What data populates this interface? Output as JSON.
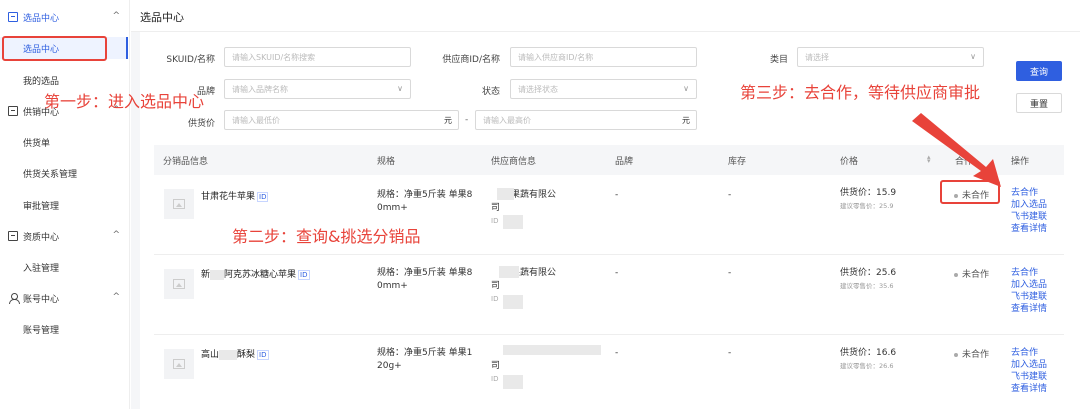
{
  "sidebar": {
    "groups": [
      {
        "label": "选品中心",
        "items": [
          "选品中心",
          "我的选品"
        ]
      },
      {
        "label": "供销中心",
        "items": [
          "供货单",
          "供货关系管理",
          "审批管理"
        ]
      },
      {
        "label": "资质中心",
        "items": [
          "入驻管理"
        ]
      },
      {
        "label": "账号中心",
        "items": [
          "账号管理"
        ]
      }
    ],
    "chevron": "^"
  },
  "page": {
    "title": "选品中心"
  },
  "filters": {
    "skuid_label": "SKUID/名称",
    "skuid_placeholder": "请输入SKUID/名称搜索",
    "supplier_label": "供应商ID/名称",
    "supplier_placeholder": "请输入供应商ID/名称",
    "category_label": "类目",
    "category_placeholder": "请选择",
    "brand_label": "品牌",
    "brand_placeholder": "请输入品牌名称",
    "status_label": "状态",
    "status_placeholder": "请选择状态",
    "price_label": "供货价",
    "price_min_placeholder": "请输入最低价",
    "price_max_placeholder": "请输入最高价",
    "unit": "元",
    "range_sep": "-",
    "query_button": "查询",
    "reset_button": "重置"
  },
  "table": {
    "columns": [
      "分销品信息",
      "规格",
      "供应商信息",
      "品牌",
      "库存",
      "价格",
      "合作",
      "操作"
    ],
    "id_badge": "ID",
    "rows": [
      {
        "name": "甘肃花牛苹果",
        "spec_line1": "规格：净重5斤装 单果8",
        "spec_line2": "0mm+",
        "supplier_line1": "果蔬有限公",
        "supplier_line2": "司",
        "supplier_line3": "ID",
        "brand": "-",
        "stock": "-",
        "price": "供货价：15.9",
        "suggest": "建议零售价：25.9",
        "status": "未合作",
        "ops": [
          "去合作",
          "加入选品",
          "飞书建联",
          "查看详情"
        ]
      },
      {
        "name": "新疆阿克苏冰糖心苹果",
        "name_a": "新",
        "name_b": "阿克苏冰糖心苹果",
        "spec_line1": "规格：净重5斤装 单果8",
        "spec_line2": "0mm+",
        "supplier_line1": "果蔬有限公",
        "supplier_line2": "司",
        "supplier_line3": "ID",
        "brand": "-",
        "stock": "-",
        "price": "供货价：25.6",
        "suggest": "建议零售价：35.6",
        "status": "未合作",
        "ops": [
          "去合作",
          "加入选品",
          "飞书建联",
          "查看详情"
        ]
      },
      {
        "name_a": "高山",
        "name_b": "酥梨",
        "spec_line1": "规格：净重5斤装 单果1",
        "spec_line2": "20g+",
        "supplier_line1": "",
        "supplier_line2": "司",
        "supplier_line3": "ID",
        "brand": "-",
        "stock": "-",
        "price": "供货价：16.6",
        "suggest": "建议零售价：26.6",
        "status": "未合作",
        "ops": [
          "去合作",
          "加入选品",
          "飞书建联",
          "查看详情"
        ]
      }
    ]
  },
  "annotations": {
    "step1": "第一步：进入选品中心",
    "step2": "第二步：查询&挑选分销品",
    "step3": "第三步：去合作，等待供应商审批",
    "accent": "#e8433a"
  },
  "colors": {
    "primary": "#2f5fe0",
    "annotation": "#e8433a"
  }
}
